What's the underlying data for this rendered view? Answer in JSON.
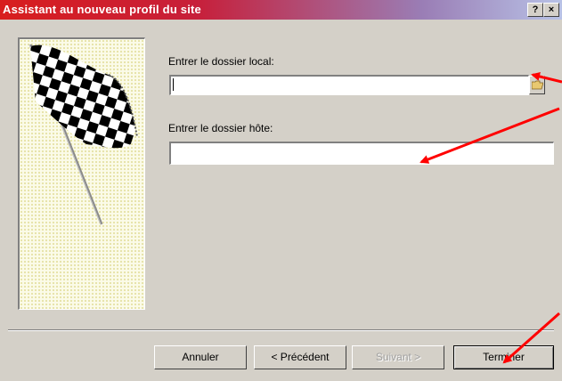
{
  "window": {
    "title": "Assistant au nouveau profil du site",
    "help_label": "?",
    "close_label": "×"
  },
  "form": {
    "local_label": "Entrer le dossier local:",
    "local_value": "",
    "host_label": "Entrer le dossier hôte:",
    "host_value": ""
  },
  "buttons": {
    "cancel": "Annuler",
    "previous": "< Précédent",
    "next": "Suivant >",
    "finish": "Terminer"
  },
  "colors": {
    "titlebar_start": "#d81e1e",
    "titlebar_end": "#b8c2e6",
    "face": "#d4d0c8",
    "annotation_arrow": "#ff0000"
  },
  "icons": {
    "banner": "checkered-flag-icon",
    "browse": "folder-icon"
  }
}
